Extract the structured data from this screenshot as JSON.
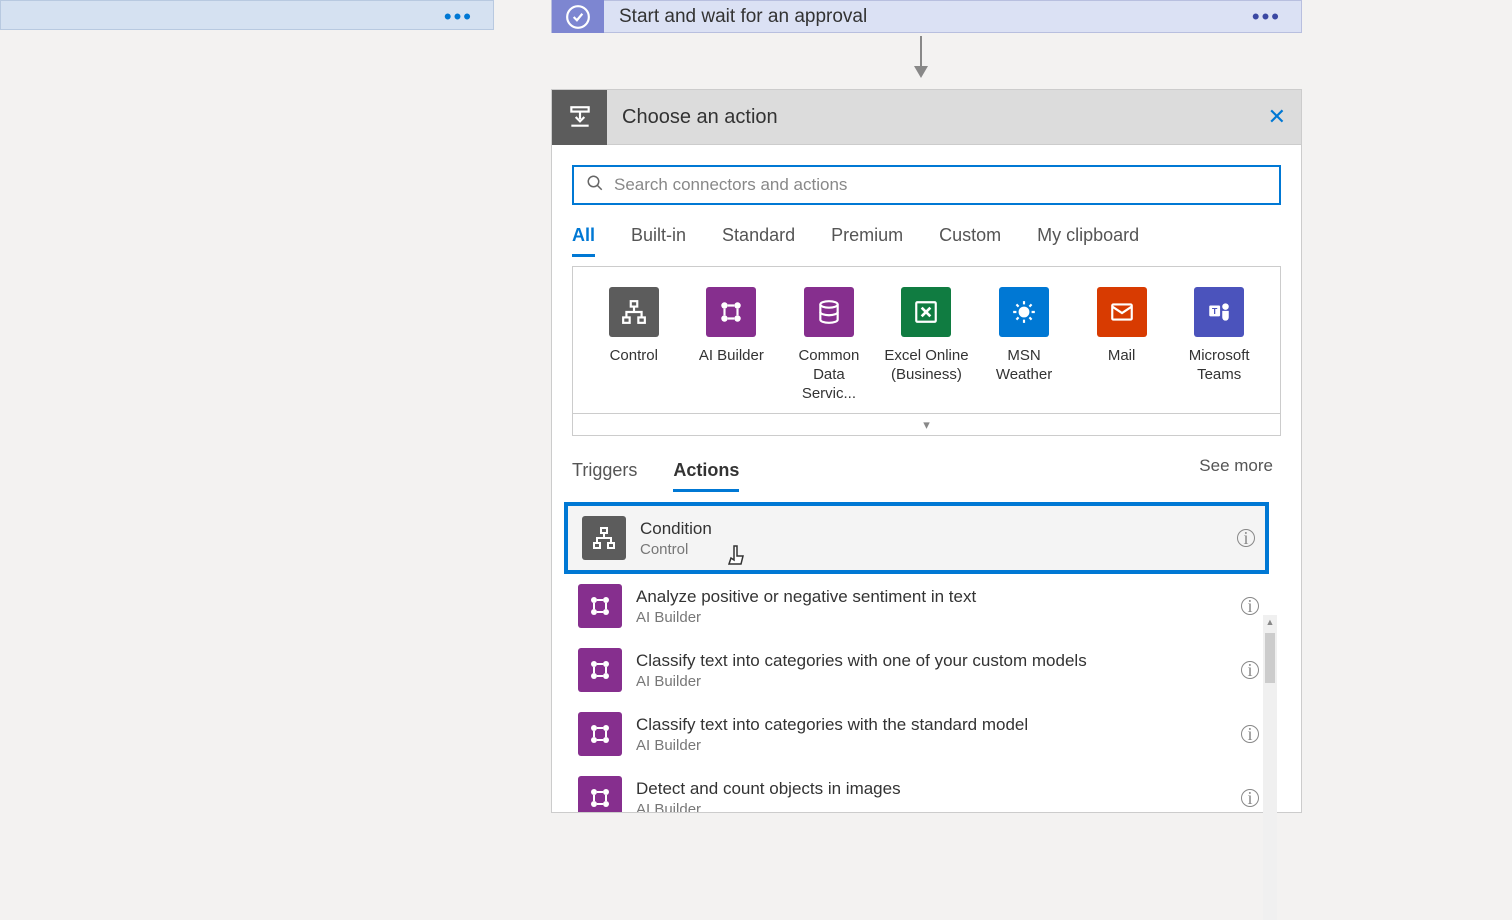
{
  "approval": {
    "title": "Start and wait for an approval"
  },
  "chooseAction": {
    "title": "Choose an action"
  },
  "search": {
    "placeholder": "Search connectors and actions"
  },
  "filterTabs": [
    "All",
    "Built-in",
    "Standard",
    "Premium",
    "Custom",
    "My clipboard"
  ],
  "activeFilterTab": 0,
  "connectors": [
    {
      "label": "Control",
      "color": "bg-gray"
    },
    {
      "label": "AI Builder",
      "color": "bg-purple"
    },
    {
      "label": "Common Data Servic...",
      "color": "bg-purple"
    },
    {
      "label": "Excel Online (Business)",
      "color": "bg-green"
    },
    {
      "label": "MSN Weather",
      "color": "bg-blue"
    },
    {
      "label": "Mail",
      "color": "bg-red"
    },
    {
      "label": "Microsoft Teams",
      "color": "bg-teams"
    }
  ],
  "subTabs": {
    "triggers": "Triggers",
    "actions": "Actions",
    "seeMore": "See more"
  },
  "activeSubTab": "actions",
  "actions": [
    {
      "name": "Condition",
      "category": "Control",
      "color": "bg-gray",
      "highlighted": true
    },
    {
      "name": "Analyze positive or negative sentiment in text",
      "category": "AI Builder",
      "color": "bg-purple"
    },
    {
      "name": "Classify text into categories with one of your custom models",
      "category": "AI Builder",
      "color": "bg-purple"
    },
    {
      "name": "Classify text into categories with the standard model",
      "category": "AI Builder",
      "color": "bg-purple"
    },
    {
      "name": "Detect and count objects in images",
      "category": "AI Builder",
      "color": "bg-purple"
    }
  ]
}
